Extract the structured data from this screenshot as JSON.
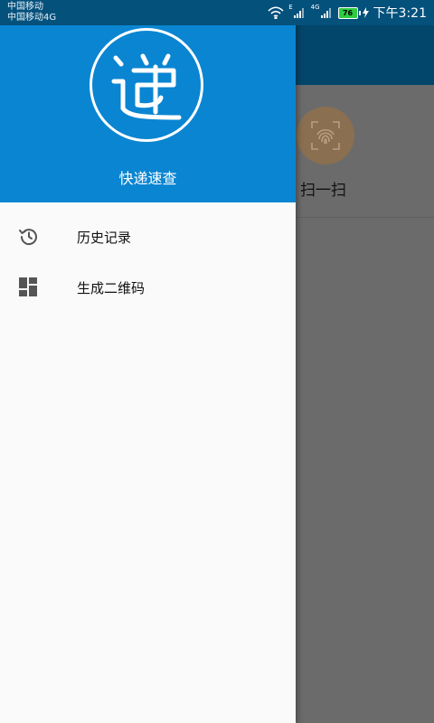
{
  "status_bar": {
    "carrier_1": "中国移动",
    "carrier_2": "中国移动4G",
    "signal_1_tag": "E",
    "signal_2_tag": "4G",
    "battery": "76",
    "time": "下午3:21"
  },
  "drawer": {
    "title": "快递速查",
    "header_color": "#0a85d2",
    "items": [
      {
        "label": "历史记录",
        "icon": "history-icon"
      },
      {
        "label": "生成二维码",
        "icon": "dashboard-grid-icon"
      }
    ]
  },
  "background_app": {
    "toolbar_color": "#03466b",
    "scan_label": "扫一扫",
    "scan_icon": "fingerprint-scan-icon"
  }
}
